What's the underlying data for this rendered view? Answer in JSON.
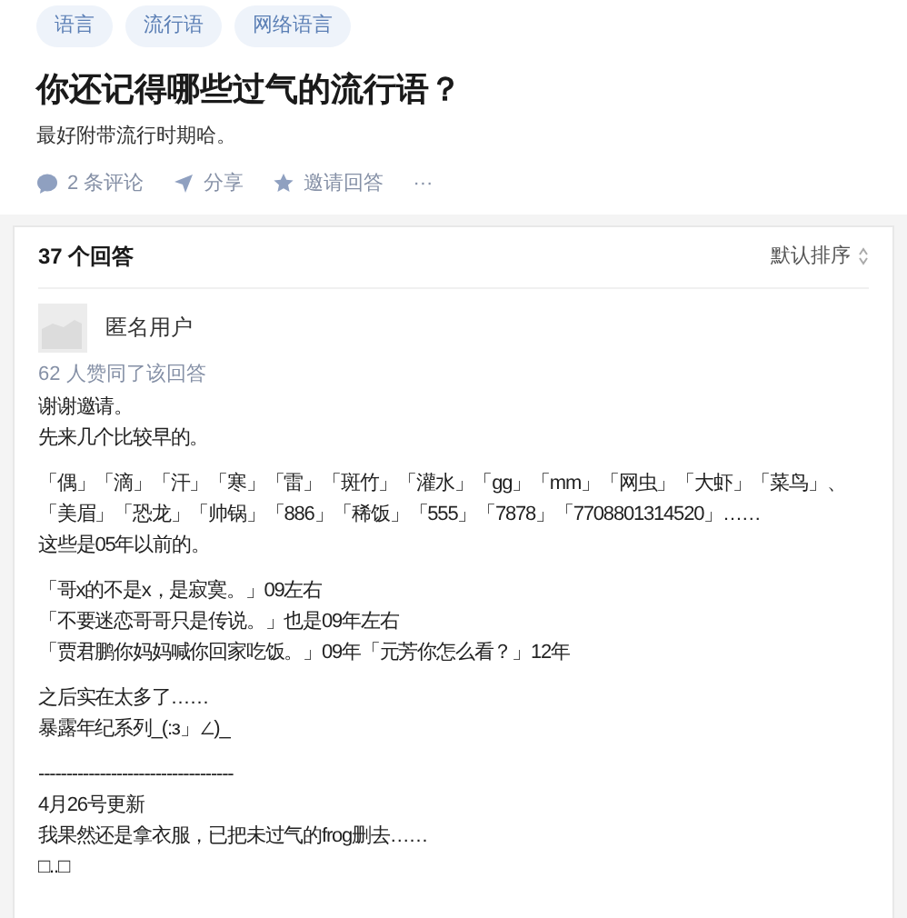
{
  "topics": [
    "语言",
    "流行语",
    "网络语言"
  ],
  "question": {
    "title": "你还记得哪些过气的流行语？",
    "detail": "最好附带流行时期哈。"
  },
  "actions": [
    {
      "kind": "comment",
      "label": "2 条评论"
    },
    {
      "kind": "share",
      "label": "分享"
    },
    {
      "kind": "invite",
      "label": "邀请回答"
    },
    {
      "kind": "more",
      "label": "···"
    }
  ],
  "answers_header": {
    "count": "37 个回答",
    "sort": "默认排序"
  },
  "answer": {
    "author": "匿名用户",
    "votes": "62 人赞同了该回答",
    "paragraphs": [
      [
        "谢谢邀请。",
        "先来几个比较早的。"
      ],
      [
        "「偶」「滴」「汗」「寒」「雷」「斑竹」「灌水」「gg」「mm」「网虫」「大虾」「菜鸟」、",
        "「美眉」「恐龙」「帅锅」「886」「稀饭」「555」「7878」「7708801314520」……",
        "这些是05年以前的。"
      ],
      [
        "「哥x的不是x，是寂寞。」09左右",
        "「不要迷恋哥哥只是传说。」也是09年左右",
        "「贾君鹏你妈妈喊你回家吃饭。」09年「元芳你怎么看？」12年"
      ],
      [
        "之后实在太多了……",
        "暴露年纪系列_(:з」∠)_"
      ],
      [
        "-----------------------------------",
        "4月26号更新",
        "我果然还是拿衣服，已把未过气的frog删去……",
        "□..□"
      ]
    ]
  }
}
